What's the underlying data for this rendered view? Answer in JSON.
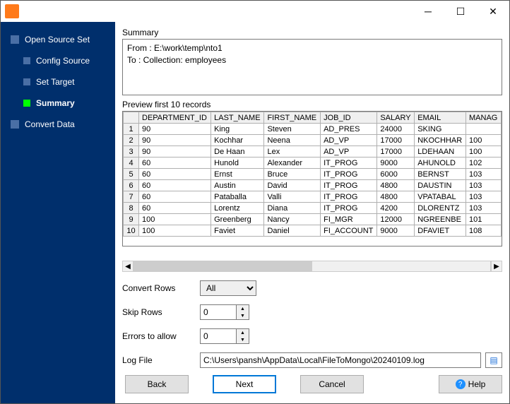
{
  "nav": {
    "open_source_set": "Open Source Set",
    "config_source": "Config Source",
    "set_target": "Set Target",
    "summary": "Summary",
    "convert_data": "Convert Data"
  },
  "summary": {
    "label": "Summary",
    "from": "From : E:\\work\\temp\\nto1",
    "to": "To : Collection: employees"
  },
  "preview": {
    "label": "Preview first 10 records",
    "columns": [
      "DEPARTMENT_ID",
      "LAST_NAME",
      "FIRST_NAME",
      "JOB_ID",
      "SALARY",
      "EMAIL",
      "MANAG"
    ],
    "rows": [
      {
        "n": "1",
        "DEPARTMENT_ID": "90",
        "LAST_NAME": "King",
        "FIRST_NAME": "Steven",
        "JOB_ID": "AD_PRES",
        "SALARY": "24000",
        "EMAIL": "SKING",
        "MANAG": ""
      },
      {
        "n": "2",
        "DEPARTMENT_ID": "90",
        "LAST_NAME": "Kochhar",
        "FIRST_NAME": "Neena",
        "JOB_ID": "AD_VP",
        "SALARY": "17000",
        "EMAIL": "NKOCHHAR",
        "MANAG": "100"
      },
      {
        "n": "3",
        "DEPARTMENT_ID": "90",
        "LAST_NAME": "De Haan",
        "FIRST_NAME": "Lex",
        "JOB_ID": "AD_VP",
        "SALARY": "17000",
        "EMAIL": "LDEHAAN",
        "MANAG": "100"
      },
      {
        "n": "4",
        "DEPARTMENT_ID": "60",
        "LAST_NAME": "Hunold",
        "FIRST_NAME": "Alexander",
        "JOB_ID": "IT_PROG",
        "SALARY": "9000",
        "EMAIL": "AHUNOLD",
        "MANAG": "102"
      },
      {
        "n": "5",
        "DEPARTMENT_ID": "60",
        "LAST_NAME": "Ernst",
        "FIRST_NAME": "Bruce",
        "JOB_ID": "IT_PROG",
        "SALARY": "6000",
        "EMAIL": "BERNST",
        "MANAG": "103"
      },
      {
        "n": "6",
        "DEPARTMENT_ID": "60",
        "LAST_NAME": "Austin",
        "FIRST_NAME": "David",
        "JOB_ID": "IT_PROG",
        "SALARY": "4800",
        "EMAIL": "DAUSTIN",
        "MANAG": "103"
      },
      {
        "n": "7",
        "DEPARTMENT_ID": "60",
        "LAST_NAME": "Pataballa",
        "FIRST_NAME": "Valli",
        "JOB_ID": "IT_PROG",
        "SALARY": "4800",
        "EMAIL": "VPATABAL",
        "MANAG": "103"
      },
      {
        "n": "8",
        "DEPARTMENT_ID": "60",
        "LAST_NAME": "Lorentz",
        "FIRST_NAME": "Diana",
        "JOB_ID": "IT_PROG",
        "SALARY": "4200",
        "EMAIL": "DLORENTZ",
        "MANAG": "103"
      },
      {
        "n": "9",
        "DEPARTMENT_ID": "100",
        "LAST_NAME": "Greenberg",
        "FIRST_NAME": "Nancy",
        "JOB_ID": "FI_MGR",
        "SALARY": "12000",
        "EMAIL": "NGREENBE",
        "MANAG": "101"
      },
      {
        "n": "10",
        "DEPARTMENT_ID": "100",
        "LAST_NAME": "Faviet",
        "FIRST_NAME": "Daniel",
        "JOB_ID": "FI_ACCOUNT",
        "SALARY": "9000",
        "EMAIL": "DFAVIET",
        "MANAG": "108"
      }
    ]
  },
  "form": {
    "convert_rows_label": "Convert Rows",
    "convert_rows_value": "All",
    "skip_rows_label": "Skip Rows",
    "skip_rows_value": "0",
    "errors_label": "Errors to allow",
    "errors_value": "0",
    "log_file_label": "Log File",
    "log_file_value": "C:\\Users\\pansh\\AppData\\Local\\FileToMongo\\20240109.log"
  },
  "buttons": {
    "back": "Back",
    "next": "Next",
    "cancel": "Cancel",
    "help": "Help"
  }
}
